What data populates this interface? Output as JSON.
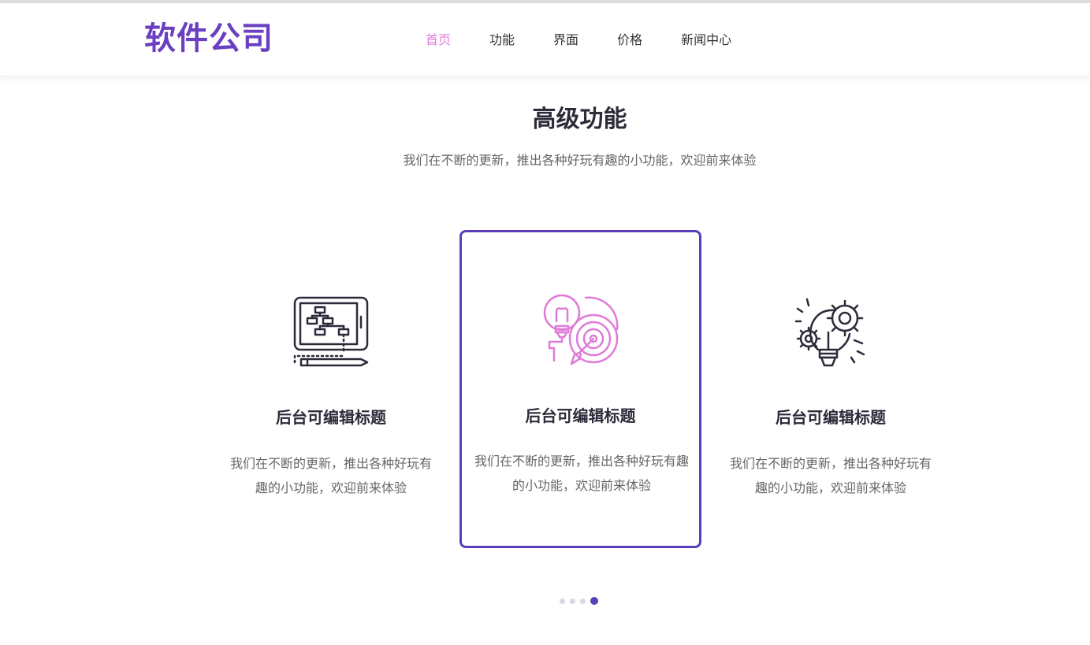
{
  "brand": {
    "name": "软件公司",
    "color": "#6a3fc1"
  },
  "nav": {
    "items": [
      {
        "label": "首页",
        "active": true
      },
      {
        "label": "功能",
        "active": false
      },
      {
        "label": "界面",
        "active": false
      },
      {
        "label": "价格",
        "active": false
      },
      {
        "label": "新闻中心",
        "active": false
      }
    ],
    "active_color": "#e07ad8"
  },
  "features": {
    "title": "高级功能",
    "subtitle": "我们在不断的更新，推出各种好玩有趣的小功能，欢迎前来体验",
    "cards": [
      {
        "icon": "tablet-flowchart-icon",
        "title": "后台可编辑标题",
        "desc": "我们在不断的更新，推出各种好玩有趣的小功能，欢迎前来体验"
      },
      {
        "icon": "lightbulb-target-icon",
        "title": "后台可编辑标题",
        "desc": "我们在不断的更新，推出各种好玩有趣的小功能，欢迎前来体验",
        "active": true
      },
      {
        "icon": "gear-lightbulb-icon",
        "title": "后台可编辑标题",
        "desc": "我们在不断的更新，推出各种好玩有趣的小功能，欢迎前来体验"
      }
    ],
    "accent_color": "#5b3fba"
  },
  "pagination": {
    "count": 4,
    "active_index": 3
  }
}
